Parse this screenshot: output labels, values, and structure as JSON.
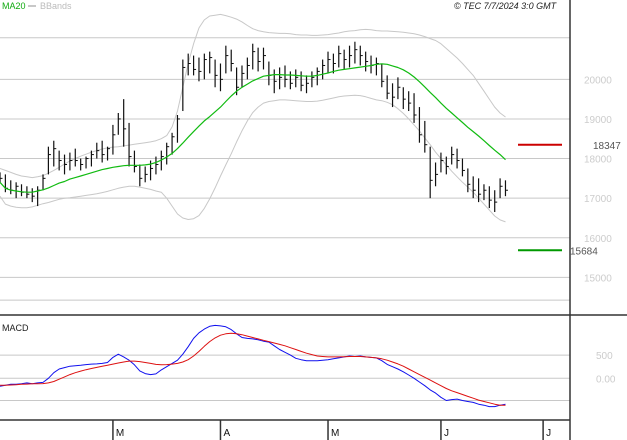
{
  "chart_data": {
    "type": "line",
    "header": {
      "legend_ma20": "MA20",
      "legend_bbands": "BBands",
      "watermark": "© TEC 7/7/2024 3:0 GMT"
    },
    "price_panel": {
      "y_ticks": [
        "20000",
        "19000",
        "18000",
        "17000",
        "16000",
        "15000"
      ],
      "y_tick_values": [
        20000,
        19000,
        18000,
        17000,
        16000,
        15000
      ],
      "ylim": [
        14100,
        21650
      ],
      "resistance": {
        "label": "18347",
        "value": 18347,
        "color": "#cc0000"
      },
      "support": {
        "label": "15684",
        "value": 15684,
        "color": "#009900"
      },
      "candles_hlc": [
        [
          17650,
          17400,
          17500
        ],
        [
          17600,
          17150,
          17250
        ],
        [
          17450,
          17100,
          17200
        ],
        [
          17400,
          17000,
          17300
        ],
        [
          17350,
          17050,
          17150
        ],
        [
          17300,
          17000,
          17100
        ],
        [
          17250,
          16900,
          17050
        ],
        [
          17300,
          16800,
          17200
        ],
        [
          17600,
          17200,
          17500
        ],
        [
          18300,
          17600,
          18100
        ],
        [
          18450,
          17800,
          18250
        ],
        [
          18200,
          17700,
          17950
        ],
        [
          18100,
          17600,
          17850
        ],
        [
          18150,
          17700,
          17950
        ],
        [
          18250,
          17800,
          17950
        ],
        [
          18000,
          17700,
          17850
        ],
        [
          18050,
          17750,
          18000
        ],
        [
          18200,
          17800,
          18100
        ],
        [
          18400,
          18000,
          18200
        ],
        [
          18450,
          17900,
          18100
        ],
        [
          18300,
          17950,
          18250
        ],
        [
          18850,
          18100,
          18600
        ],
        [
          19150,
          18600,
          19000
        ],
        [
          19500,
          18300,
          18750
        ],
        [
          18900,
          17800,
          18050
        ],
        [
          18200,
          17650,
          17800
        ],
        [
          17850,
          17300,
          17500
        ],
        [
          17800,
          17400,
          17600
        ],
        [
          17950,
          17450,
          17750
        ],
        [
          18050,
          17600,
          17850
        ],
        [
          18200,
          17700,
          18050
        ],
        [
          18400,
          17850,
          18300
        ],
        [
          18650,
          18100,
          18550
        ],
        [
          19100,
          18400,
          19000
        ],
        [
          20500,
          19200,
          20300
        ],
        [
          20650,
          20100,
          20400
        ],
        [
          20600,
          20100,
          20250
        ],
        [
          20550,
          19950,
          20200
        ],
        [
          20650,
          20000,
          20500
        ],
        [
          20700,
          20150,
          20550
        ],
        [
          20500,
          19800,
          20100
        ],
        [
          20400,
          19700,
          20000
        ],
        [
          20850,
          20150,
          20600
        ],
        [
          20750,
          20200,
          20400
        ],
        [
          20300,
          19600,
          19800
        ],
        [
          20350,
          19800,
          20150
        ],
        [
          20550,
          20000,
          20350
        ],
        [
          20900,
          20250,
          20700
        ],
        [
          20800,
          20200,
          20450
        ],
        [
          20800,
          20250,
          20600
        ],
        [
          20450,
          19850,
          20100
        ],
        [
          20250,
          19650,
          19950
        ],
        [
          20300,
          19750,
          20050
        ],
        [
          20350,
          19800,
          20000
        ],
        [
          20200,
          19750,
          19900
        ],
        [
          20250,
          19800,
          20050
        ],
        [
          20200,
          19700,
          19850
        ],
        [
          20100,
          19650,
          19900
        ],
        [
          20200,
          19800,
          20050
        ],
        [
          20300,
          19850,
          20200
        ],
        [
          20500,
          20000,
          20350
        ],
        [
          20700,
          20150,
          20500
        ],
        [
          20650,
          20150,
          20400
        ],
        [
          20850,
          20300,
          20650
        ],
        [
          20750,
          20250,
          20500
        ],
        [
          20850,
          20300,
          20600
        ],
        [
          20950,
          20400,
          20750
        ],
        [
          20850,
          20350,
          20600
        ],
        [
          20700,
          20200,
          20450
        ],
        [
          20600,
          20150,
          20350
        ],
        [
          20550,
          20100,
          20400
        ],
        [
          20400,
          19800,
          19950
        ],
        [
          20100,
          19500,
          19650
        ],
        [
          19900,
          19300,
          19550
        ],
        [
          20050,
          19500,
          19800
        ],
        [
          19800,
          19250,
          19500
        ],
        [
          19700,
          19200,
          19400
        ],
        [
          19650,
          18900,
          19100
        ],
        [
          19300,
          18400,
          18600
        ],
        [
          18950,
          18150,
          18350
        ],
        [
          18300,
          17000,
          17450
        ],
        [
          17900,
          17300,
          17600
        ],
        [
          18150,
          17650,
          17950
        ],
        [
          18050,
          17600,
          17800
        ],
        [
          18300,
          17850,
          18100
        ],
        [
          18250,
          17750,
          17950
        ],
        [
          18000,
          17550,
          17700
        ],
        [
          17750,
          17150,
          17350
        ],
        [
          17550,
          17000,
          17200
        ],
        [
          17500,
          16900,
          17100
        ],
        [
          17350,
          16950,
          17200
        ],
        [
          17300,
          16750,
          16950
        ],
        [
          17200,
          16650,
          16900
        ],
        [
          17500,
          17000,
          17300
        ],
        [
          17450,
          17050,
          17200
        ]
      ],
      "ma20": [
        17400,
        17250,
        17200,
        17180,
        17160,
        17150,
        17150,
        17180,
        17210,
        17260,
        17320,
        17380,
        17420,
        17480,
        17520,
        17560,
        17600,
        17640,
        17680,
        17720,
        17750,
        17780,
        17800,
        17820,
        17830,
        17830,
        17830,
        17840,
        17860,
        17900,
        17960,
        18040,
        18130,
        18250,
        18390,
        18540,
        18680,
        18820,
        18950,
        19060,
        19180,
        19300,
        19440,
        19580,
        19700,
        19800,
        19880,
        19960,
        20020,
        20080,
        20100,
        20120,
        20120,
        20110,
        20110,
        20100,
        20090,
        20080,
        20080,
        20100,
        20130,
        20160,
        20200,
        20230,
        20250,
        20270,
        20290,
        20310,
        20330,
        20350,
        20380,
        20390,
        20380,
        20340,
        20300,
        20240,
        20160,
        20060,
        19940,
        19810,
        19670,
        19540,
        19400,
        19270,
        19150,
        19030,
        18910,
        18790,
        18680,
        18570,
        18450,
        18330,
        18210,
        18100,
        17970
      ],
      "bb_upper": [
        17750,
        17700,
        17650,
        17600,
        17560,
        17540,
        17520,
        17540,
        17570,
        17630,
        17700,
        17780,
        17860,
        17940,
        18000,
        18060,
        18110,
        18160,
        18200,
        18240,
        18270,
        18290,
        18300,
        18320,
        18340,
        18360,
        18380,
        18400,
        18420,
        18450,
        18500,
        18580,
        18800,
        19200,
        19800,
        20400,
        20900,
        21300,
        21500,
        21600,
        21620,
        21640,
        21610,
        21570,
        21520,
        21450,
        21360,
        21280,
        21230,
        21200,
        21180,
        21170,
        21160,
        21160,
        21150,
        21130,
        21120,
        21120,
        21110,
        21110,
        21120,
        21130,
        21150,
        21170,
        21200,
        21220,
        21230,
        21250,
        21260,
        21250,
        21230,
        21220,
        21220,
        21210,
        21200,
        21190,
        21170,
        21150,
        21120,
        21080,
        21030,
        20980,
        20900,
        20780,
        20660,
        20540,
        20400,
        20250,
        20100,
        19900,
        19700,
        19500,
        19300,
        19150,
        19050
      ],
      "bb_lower": [
        17050,
        16850,
        16800,
        16770,
        16760,
        16760,
        16780,
        16820,
        16860,
        16890,
        16930,
        16970,
        17000,
        17010,
        17030,
        17050,
        17070,
        17090,
        17110,
        17140,
        17170,
        17210,
        17250,
        17280,
        17300,
        17300,
        17280,
        17250,
        17220,
        17180,
        17150,
        17000,
        16800,
        16600,
        16500,
        16460,
        16480,
        16560,
        16740,
        16980,
        17260,
        17560,
        17840,
        18120,
        18420,
        18700,
        18950,
        19160,
        19300,
        19400,
        19440,
        19460,
        19480,
        19480,
        19470,
        19460,
        19450,
        19440,
        19440,
        19450,
        19470,
        19500,
        19530,
        19560,
        19580,
        19590,
        19600,
        19590,
        19560,
        19520,
        19480,
        19460,
        19420,
        19360,
        19260,
        19140,
        19000,
        18850,
        18700,
        18520,
        18350,
        18160,
        18000,
        17840,
        17680,
        17540,
        17400,
        17280,
        17150,
        17000,
        16850,
        16700,
        16550,
        16450,
        16400
      ]
    },
    "macd_panel": {
      "label": "MACD",
      "y_ticks": [
        "500",
        "0.00"
      ],
      "y_tick_values": [
        500,
        0
      ],
      "ylim": [
        -900,
        1300
      ],
      "macd": [
        -170,
        -150,
        -130,
        -130,
        -120,
        -100,
        -120,
        -100,
        -90,
        0,
        120,
        200,
        230,
        260,
        270,
        280,
        295,
        305,
        310,
        320,
        340,
        450,
        520,
        460,
        390,
        290,
        160,
        100,
        80,
        95,
        180,
        250,
        320,
        390,
        520,
        680,
        860,
        980,
        1060,
        1120,
        1140,
        1130,
        1110,
        1050,
        960,
        880,
        860,
        850,
        830,
        800,
        780,
        700,
        620,
        560,
        500,
        430,
        400,
        380,
        380,
        380,
        390,
        400,
        420,
        440,
        460,
        480,
        470,
        480,
        460,
        450,
        440,
        380,
        300,
        250,
        200,
        140,
        70,
        0,
        -80,
        -160,
        -250,
        -320,
        -410,
        -480,
        -460,
        -450,
        -480,
        -500,
        -520,
        -560,
        -580,
        -610,
        -610,
        -580,
        -560
      ],
      "signal": [
        -150,
        -150,
        -145,
        -140,
        -130,
        -125,
        -120,
        -118,
        -115,
        -100,
        -70,
        -20,
        30,
        80,
        120,
        155,
        185,
        210,
        235,
        260,
        280,
        305,
        330,
        350,
        370,
        370,
        360,
        340,
        320,
        300,
        290,
        295,
        305,
        320,
        350,
        400,
        480,
        580,
        690,
        790,
        870,
        930,
        960,
        970,
        960,
        940,
        910,
        880,
        850,
        820,
        790,
        760,
        730,
        700,
        660,
        620,
        580,
        540,
        510,
        480,
        470,
        460,
        460,
        460,
        465,
        470,
        470,
        470,
        460,
        450,
        440,
        420,
        390,
        350,
        310,
        260,
        200,
        140,
        80,
        20,
        -40,
        -100,
        -160,
        -220,
        -270,
        -310,
        -350,
        -390,
        -430,
        -470,
        -500,
        -530,
        -560,
        -580,
        -580
      ],
      "macd_color": "#1010ee",
      "signal_color": "#dd1111"
    },
    "x_axis": {
      "tick_labels": [
        "M",
        "A",
        "M",
        "J",
        "J"
      ],
      "tick_indices": [
        21,
        41,
        61,
        82,
        101
      ],
      "xlim": [
        0,
        106
      ]
    },
    "colors": {
      "ma20": "#11bb11",
      "bbands": "#c8c8c8",
      "candles": "#111111",
      "grid": "#c8c8c8",
      "panel_border": "#333333",
      "tick_text": "#cccccc"
    }
  }
}
